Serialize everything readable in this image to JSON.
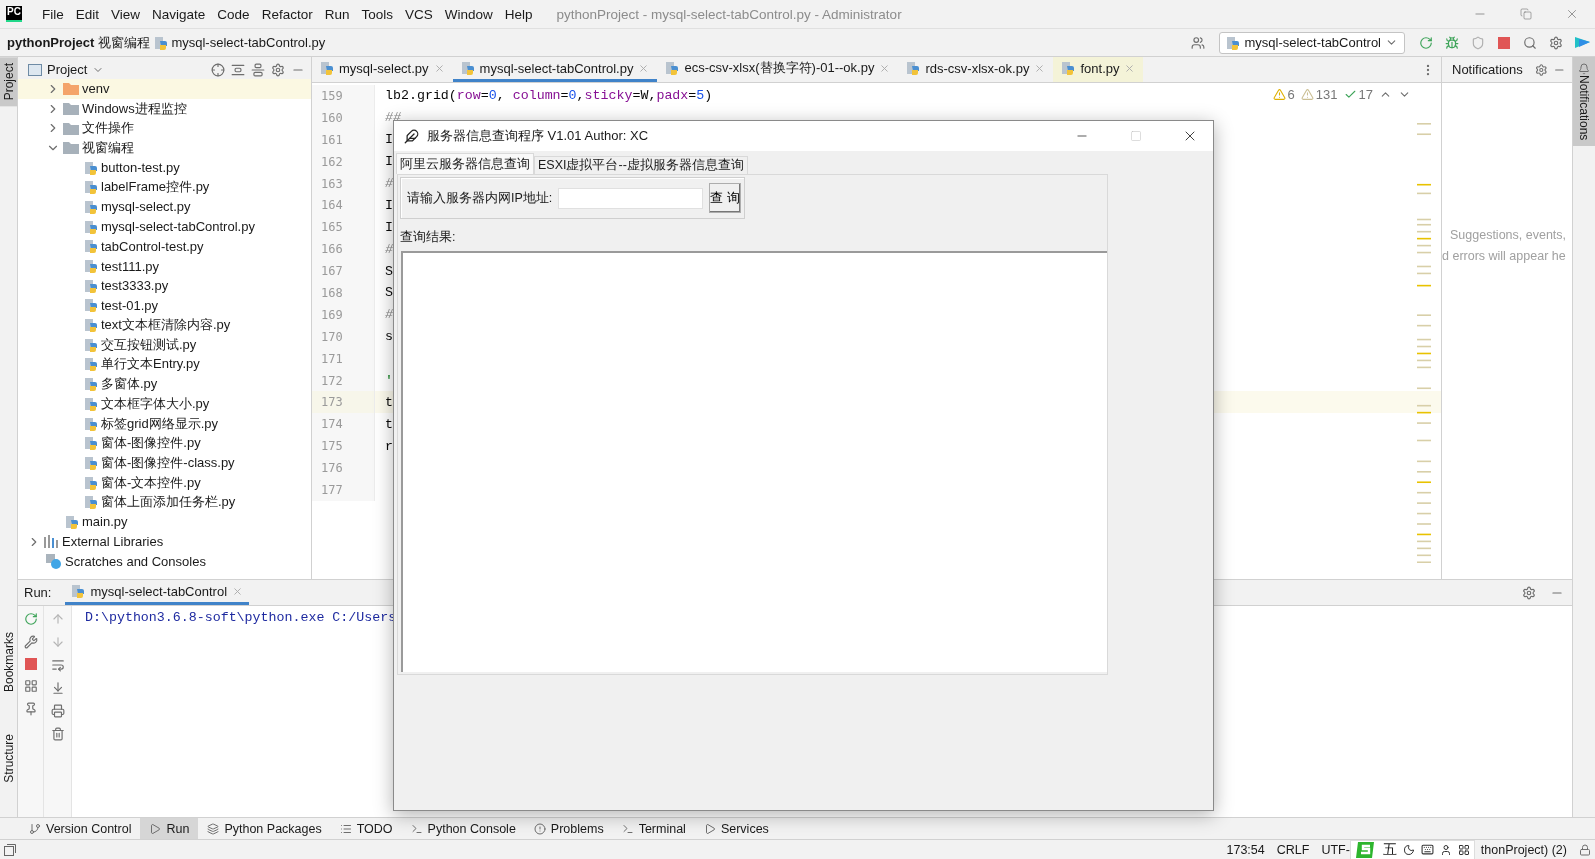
{
  "title_bar": {
    "logo": "PC",
    "menu": [
      "File",
      "Edit",
      "View",
      "Navigate",
      "Code",
      "Refactor",
      "Run",
      "Tools",
      "VCS",
      "Window",
      "Help"
    ],
    "title": "pythonProject - mysql-select-tabControl.py - Administrator"
  },
  "nav_bar": {
    "breadcrumb": [
      "pythonProject",
      "视窗编程",
      "mysql-select-tabControl.py"
    ],
    "run_config": "mysql-select-tabControl"
  },
  "left_stripe": [
    {
      "label": "Project",
      "selected": true
    },
    {
      "label": "Bookmarks",
      "selected": false
    },
    {
      "label": "Structure",
      "selected": false
    }
  ],
  "project": {
    "title": "Project",
    "tree": [
      {
        "label": "venv",
        "kind": "excluded_folder",
        "expanded": false,
        "selected": true
      },
      {
        "label": "Windows进程监控",
        "kind": "folder",
        "expanded": false,
        "selected": false
      },
      {
        "label": "文件操作",
        "kind": "folder",
        "expanded": false,
        "selected": false
      },
      {
        "label": "视窗编程",
        "kind": "folder",
        "expanded": true,
        "selected": false,
        "children": [
          {
            "label": "button-test.py",
            "kind": "file",
            "selected": false
          },
          {
            "label": "labelFrame控件.py",
            "kind": "file",
            "selected": false
          },
          {
            "label": "mysql-select.py",
            "kind": "file",
            "selected": false
          },
          {
            "label": "mysql-select-tabControl.py",
            "kind": "file",
            "selected": false
          },
          {
            "label": "tabControl-test.py",
            "kind": "file",
            "selected": false
          },
          {
            "label": "test111.py",
            "kind": "file",
            "selected": false
          },
          {
            "label": "test3333.py",
            "kind": "file",
            "selected": false
          },
          {
            "label": "test-01.py",
            "kind": "file",
            "selected": false
          },
          {
            "label": "text文本框清除内容.py",
            "kind": "file",
            "selected": false
          },
          {
            "label": "交互按钮测试.py",
            "kind": "file",
            "selected": false
          },
          {
            "label": "单行文本Entry.py",
            "kind": "file",
            "selected": false
          },
          {
            "label": "多窗体.py",
            "kind": "file",
            "selected": false
          },
          {
            "label": "文本框字体大小.py",
            "kind": "file",
            "selected": false
          },
          {
            "label": "标签grid网络显示.py",
            "kind": "file",
            "selected": false
          },
          {
            "label": "窗体-图像控件.py",
            "kind": "file",
            "selected": false
          },
          {
            "label": "窗体-图像控件-class.py",
            "kind": "file",
            "selected": false
          },
          {
            "label": "窗体-文本控件.py",
            "kind": "file",
            "selected": false
          },
          {
            "label": "窗体上面添加任务栏.py",
            "kind": "file",
            "selected": false
          }
        ]
      },
      {
        "label": "main.py",
        "kind": "file",
        "selected": false
      },
      {
        "label": "External Libraries",
        "kind": "library",
        "expanded": false,
        "selected": false,
        "outdent": true
      },
      {
        "label": "Scratches and Consoles",
        "kind": "scratches",
        "selected": false,
        "outdent": true
      }
    ]
  },
  "editor": {
    "tabs": [
      {
        "label": "mysql-select.py",
        "selected": false,
        "highlighted": false
      },
      {
        "label": "mysql-select-tabControl.py",
        "selected": true,
        "highlighted": false
      },
      {
        "label": "ecs-csv-xlsx(替换字符)-01--ok.py",
        "selected": false,
        "highlighted": false
      },
      {
        "label": "rds-csv-xlsx-ok.py",
        "selected": false,
        "highlighted": false
      },
      {
        "label": "font.py",
        "selected": false,
        "highlighted": true
      }
    ],
    "inspections": {
      "warnings": "6",
      "weak_warnings": "131",
      "typos": "17"
    },
    "lines": [
      {
        "number": "159",
        "current": false,
        "tokens": [
          {
            "text": "lb2.grid(",
            "kind": "plain"
          },
          {
            "text": "row",
            "kind": "param"
          },
          {
            "text": "=",
            "kind": "plain"
          },
          {
            "text": "0",
            "kind": "number"
          },
          {
            "text": ", ",
            "kind": "plain"
          },
          {
            "text": "column",
            "kind": "param"
          },
          {
            "text": "=",
            "kind": "plain"
          },
          {
            "text": "0",
            "kind": "number"
          },
          {
            "text": ",",
            "kind": "plain"
          },
          {
            "text": "sticky",
            "kind": "param"
          },
          {
            "text": "=W,",
            "kind": "plain"
          },
          {
            "text": "padx",
            "kind": "param"
          },
          {
            "text": "=",
            "kind": "plain"
          },
          {
            "text": "5",
            "kind": "number"
          },
          {
            "text": ")",
            "kind": "plain"
          }
        ]
      },
      {
        "number": "160",
        "current": false,
        "tokens": [
          {
            "text": "##",
            "kind": "comment"
          }
        ]
      },
      {
        "number": "161",
        "current": false,
        "tokens": [
          {
            "text": "I",
            "kind": "plain"
          }
        ]
      },
      {
        "number": "162",
        "current": false,
        "tokens": [
          {
            "text": "I",
            "kind": "plain"
          }
        ]
      },
      {
        "number": "163",
        "current": false,
        "tokens": [
          {
            "text": "#",
            "kind": "comment"
          }
        ]
      },
      {
        "number": "164",
        "current": false,
        "tokens": [
          {
            "text": "I",
            "kind": "plain"
          }
        ]
      },
      {
        "number": "165",
        "current": false,
        "tokens": [
          {
            "text": "I",
            "kind": "plain"
          }
        ]
      },
      {
        "number": "166",
        "current": false,
        "tokens": [
          {
            "text": "#",
            "kind": "comment"
          }
        ]
      },
      {
        "number": "167",
        "current": false,
        "tokens": [
          {
            "text": "S",
            "kind": "plain"
          }
        ]
      },
      {
        "number": "168",
        "current": false,
        "tokens": [
          {
            "text": "S",
            "kind": "plain"
          }
        ]
      },
      {
        "number": "169",
        "current": false,
        "tokens": [
          {
            "text": "#",
            "kind": "comment"
          }
        ]
      },
      {
        "number": "170",
        "current": false,
        "tokens": [
          {
            "text": "s",
            "kind": "plain"
          }
        ]
      },
      {
        "number": "171",
        "current": false
      },
      {
        "number": "172",
        "current": false,
        "tokens": [
          {
            "text": "'",
            "kind": "string"
          }
        ]
      },
      {
        "number": "173",
        "current": true,
        "tokens": [
          {
            "text": "t",
            "kind": "plain"
          }
        ]
      },
      {
        "number": "174",
        "current": false,
        "tokens": [
          {
            "text": "t",
            "kind": "plain"
          }
        ]
      },
      {
        "number": "175",
        "current": false,
        "tokens": [
          {
            "text": "r",
            "kind": "plain"
          }
        ]
      },
      {
        "number": "176",
        "current": false
      },
      {
        "number": "177",
        "current": false
      }
    ]
  },
  "notifications": {
    "title": "Notifications",
    "hint": [
      "Suggestions, events,",
      "d errors will appear he"
    ]
  },
  "right_stripe": [
    {
      "label": "Notifications",
      "selected": true
    }
  ],
  "run_panel": {
    "label": "Run:",
    "tab": "mysql-select-tabControl",
    "console": "D:\\python3.6.8-soft\\python.exe C:/Users"
  },
  "bottom_tabs": [
    {
      "label": "Version Control",
      "selected": false
    },
    {
      "label": "Run",
      "selected": true
    },
    {
      "label": "Python Packages",
      "selected": false
    },
    {
      "label": "TODO",
      "selected": false
    },
    {
      "label": "Python Console",
      "selected": false
    },
    {
      "label": "Problems",
      "selected": false
    },
    {
      "label": "Terminal",
      "selected": false
    },
    {
      "label": "Services",
      "selected": false
    }
  ],
  "status_bar": {
    "position": "173:54",
    "line_separator": "CRLF",
    "encoding": "UTF-",
    "ime_mode": "五",
    "interpreter": "thonProject) (2)"
  },
  "dialog": {
    "title": "服务器信息查询程序 V1.01 Author: XC",
    "tabs": [
      {
        "label": "阿里云服务器信息查询",
        "selected": true
      },
      {
        "label": "ESXI虚拟平台--虚拟服务器信息查询",
        "selected": false
      }
    ],
    "ip_label": "请输入服务器内网IP地址:",
    "query_button": "查 询",
    "result_label": "查询结果:"
  }
}
